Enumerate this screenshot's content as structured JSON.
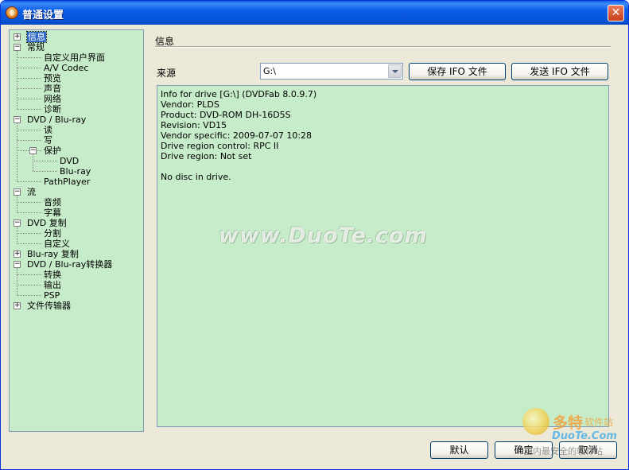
{
  "window": {
    "title": "普通设置",
    "close_glyph": "✕"
  },
  "tree": {
    "items": [
      {
        "label": "信息",
        "level": 0,
        "box": "+",
        "selected": true
      },
      {
        "label": "常规",
        "level": 0,
        "box": "−"
      },
      {
        "label": "自定义用户界面",
        "level": 1
      },
      {
        "label": "A/V Codec",
        "level": 1
      },
      {
        "label": "预览",
        "level": 1
      },
      {
        "label": "声音",
        "level": 1
      },
      {
        "label": "网络",
        "level": 1
      },
      {
        "label": "诊断",
        "level": 1
      },
      {
        "label": "DVD / Blu-ray",
        "level": 0,
        "box": "−"
      },
      {
        "label": "读",
        "level": 1
      },
      {
        "label": "写",
        "level": 1
      },
      {
        "label": "保护",
        "level": 1,
        "box": "−"
      },
      {
        "label": "DVD",
        "level": 2
      },
      {
        "label": "Blu-ray",
        "level": 2
      },
      {
        "label": "PathPlayer",
        "level": 1
      },
      {
        "label": "流",
        "level": 0,
        "box": "−"
      },
      {
        "label": "音频",
        "level": 1
      },
      {
        "label": "字幕",
        "level": 1
      },
      {
        "label": "DVD 复制",
        "level": 0,
        "box": "−"
      },
      {
        "label": "分割",
        "level": 1
      },
      {
        "label": "自定义",
        "level": 1
      },
      {
        "label": "Blu-ray 复制",
        "level": 0,
        "box": "+"
      },
      {
        "label": "DVD / Blu-ray转换器",
        "level": 0,
        "box": "−"
      },
      {
        "label": "转换",
        "level": 1
      },
      {
        "label": "输出",
        "level": 1
      },
      {
        "label": "PSP",
        "level": 1
      },
      {
        "label": "文件传输器",
        "level": 0,
        "box": "+"
      }
    ]
  },
  "main": {
    "section_title": "信息",
    "source_label": "来源",
    "source_value": "G:\\",
    "save_ifo_button": "保存 IFO 文件",
    "send_ifo_button": "发送 IFO 文件",
    "info_lines": [
      "Info for drive [G:\\] (DVDFab 8.0.9.7)",
      "Vendor: PLDS",
      "Product: DVD-ROM DH-16D5S",
      "Revision: VD15",
      "Vendor specific: 2009-07-07 10:28",
      "Drive region control: RPC II",
      "Drive region: Not set",
      "",
      "No disc in drive."
    ]
  },
  "footer": {
    "default_button": "默认",
    "ok_button": "确定",
    "cancel_button": "取消"
  },
  "watermark": {
    "text": "www.DuoTe.com",
    "logo_big": "多特",
    "logo_small": "软件站",
    "logo_domain": "DuoTe.Com",
    "logo_tagline": "国内最安全的软件站"
  }
}
